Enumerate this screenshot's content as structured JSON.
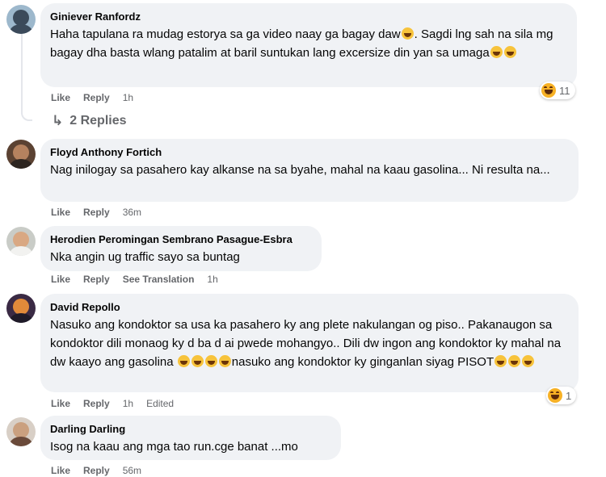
{
  "comments": [
    {
      "author": "Giniever Ranfordz",
      "text_parts": [
        "Haha tapulana ra mudag estorya sa ga video naay ga bagay daw",
        ". Sagdi lng sah na sila mg bagay dha basta wlang patalim at baril suntukan lang excersize din yan sa umaga"
      ],
      "actions": {
        "like": "Like",
        "reply": "Reply",
        "time": "1h"
      },
      "reaction": {
        "icon": "haha-icon",
        "count": "11"
      },
      "replies": "2 Replies"
    },
    {
      "author": "Floyd Anthony Fortich",
      "text": "Nag inilogay sa pasahero kay alkanse na sa byahe, mahal na kaau gasolina... Ni resulta na...",
      "actions": {
        "like": "Like",
        "reply": "Reply",
        "time": "36m"
      }
    },
    {
      "author": "Herodien Peromingan Sembrano Pasague-Esbra",
      "text": "Nka angin ug traffic sayo sa buntag",
      "actions": {
        "like": "Like",
        "reply": "Reply",
        "translate": "See Translation",
        "time": "1h"
      }
    },
    {
      "author": "David Repollo",
      "text_parts": [
        "Nasuko ang kondoktor sa usa ka pasahero ky ang plete nakulangan og piso.. Pakanaugon sa kondoktor dili monaog ky d ba d ai pwede mohangyo.. Dili dw ingon ang kondoktor ky mahal na dw kaayo ang gasolina ",
        "nasuko ang kondoktor ky ginganlan siyag PISOT"
      ],
      "actions": {
        "like": "Like",
        "reply": "Reply",
        "time": "1h",
        "edited": "Edited"
      },
      "reaction": {
        "icon": "haha-icon",
        "count": "1"
      }
    },
    {
      "author": "Darling Darling",
      "text": "Isog na kaau ang mga tao run.cge banat ...mo",
      "actions": {
        "like": "Like",
        "reply": "Reply",
        "time": "56m"
      }
    }
  ],
  "colors": {
    "bubble": "#f0f2f5",
    "secondary_text": "#65676b",
    "haha": "#f7b125"
  }
}
